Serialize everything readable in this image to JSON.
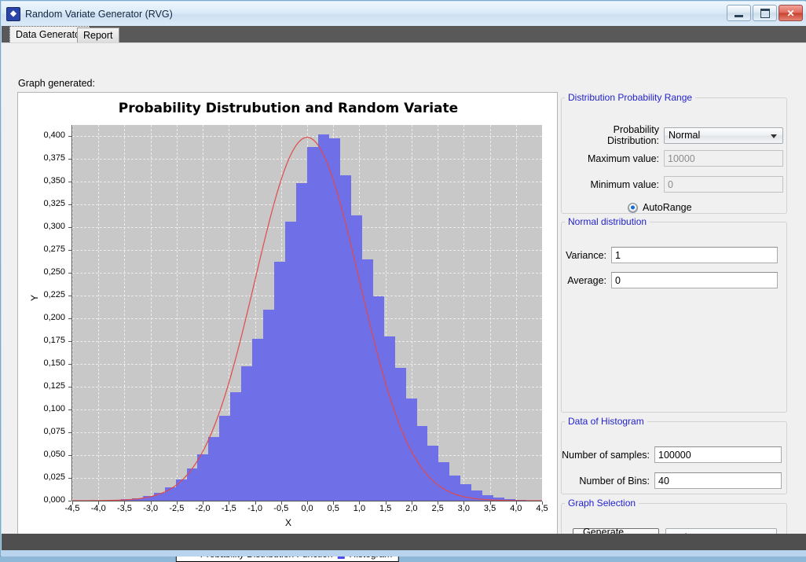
{
  "window": {
    "title": "Random Variate Generator (RVG)",
    "app_icon": "app-logo-icon",
    "minimize_label": "Minimize",
    "maximize_label": "Maximize",
    "close_label": "✕"
  },
  "tabs": [
    {
      "label": "Data Generator",
      "selected": true
    },
    {
      "label": "Report",
      "selected": false
    }
  ],
  "main": {
    "graph_label": "Graph generated:"
  },
  "chart_data": {
    "type": "bar",
    "title": "Probability Distrubution and Random Variate",
    "xlabel": "X",
    "ylabel": "Y",
    "xlim": [
      -4.5,
      4.5
    ],
    "ylim": [
      0.0,
      0.4125
    ],
    "grid": true,
    "legend_position": "bottom",
    "decimal_separator": ",",
    "xticks": [
      "-4,5",
      "-4,0",
      "-3,5",
      "-3,0",
      "-2,5",
      "-2,0",
      "-1,5",
      "-1,0",
      "-0,5",
      "0,0",
      "0,5",
      "1,0",
      "1,5",
      "2,0",
      "2,5",
      "3,0",
      "3,5",
      "4,0",
      "4,5"
    ],
    "xtick_values": [
      -4.5,
      -4.0,
      -3.5,
      -3.0,
      -2.5,
      -2.0,
      -1.5,
      -1.0,
      -0.5,
      0.0,
      0.5,
      1.0,
      1.5,
      2.0,
      2.5,
      3.0,
      3.5,
      4.0,
      4.5
    ],
    "yticks": [
      "0,000",
      "0,025",
      "0,050",
      "0,075",
      "0,100",
      "0,125",
      "0,150",
      "0,175",
      "0,200",
      "0,225",
      "0,250",
      "0,275",
      "0,300",
      "0,325",
      "0,350",
      "0,375",
      "0,400"
    ],
    "ytick_values": [
      0.0,
      0.025,
      0.05,
      0.075,
      0.1,
      0.125,
      0.15,
      0.175,
      0.2,
      0.225,
      0.25,
      0.275,
      0.3,
      0.325,
      0.35,
      0.375,
      0.4
    ],
    "series": [
      {
        "name": "Histogram",
        "type": "bar",
        "color": "#6f6fe8",
        "bin_count": 40,
        "bin_edges": [
          -4.2,
          -3.99,
          -3.78,
          -3.57,
          -3.36,
          -3.15,
          -2.94,
          -2.73,
          -2.52,
          -2.31,
          -2.1,
          -1.89,
          -1.68,
          -1.47,
          -1.26,
          -1.05,
          -0.84,
          -0.63,
          -0.42,
          -0.21,
          0.0,
          0.21,
          0.42,
          0.63,
          0.84,
          1.05,
          1.26,
          1.47,
          1.68,
          1.89,
          2.1,
          2.31,
          2.52,
          2.73,
          2.94,
          3.15,
          3.36,
          3.57,
          3.78,
          3.99,
          4.2
        ],
        "values": [
          0.0002,
          0.0004,
          0.0008,
          0.0016,
          0.003,
          0.0052,
          0.009,
          0.0148,
          0.0232,
          0.035,
          0.0506,
          0.07,
          0.093,
          0.119,
          0.148,
          0.178,
          0.21,
          0.262,
          0.306,
          0.349,
          0.388,
          0.402,
          0.398,
          0.357,
          0.313,
          0.265,
          0.224,
          0.18,
          0.146,
          0.112,
          0.082,
          0.06,
          0.042,
          0.028,
          0.018,
          0.011,
          0.0062,
          0.0034,
          0.0016,
          0.0006
        ]
      },
      {
        "name": "Probability Distribution Function",
        "type": "line",
        "color": "#e04a4a",
        "distribution": "Normal",
        "mean": 0,
        "variance": 1,
        "peak_value": 0.3989
      }
    ],
    "legend": [
      {
        "label": "Probability Distribution Function",
        "marker": "line",
        "color": "#e04a4a"
      },
      {
        "label": "Histogram",
        "marker": "square",
        "color": "#4a4aee"
      }
    ],
    "plot_background": "#c8c8c8",
    "gridline_color": "#ececec"
  },
  "panels": {
    "distribution_range": {
      "legend": "Distribution Probability Range",
      "probability_distribution_label": "Probability Distribution:",
      "probability_distribution_value": "Normal",
      "probability_distribution_options": [
        "Normal"
      ],
      "maximum_label": "Maximum value:",
      "maximum_value": "10000",
      "minimum_label": "Minimum value:",
      "minimum_value": "0",
      "autorange_label": "AutoRange",
      "autorange_checked": true
    },
    "normal_distribution": {
      "legend": "Normal distribution",
      "variance_label": "Variance:",
      "variance_value": "1",
      "average_label": "Average:",
      "average_value": "0"
    },
    "histogram_data": {
      "legend": "Data of Histogram",
      "samples_label": "Number of samples:",
      "samples_value": "100000",
      "bins_label": "Number of Bins:",
      "bins_value": "40"
    },
    "graph_selection": {
      "legend": "Graph Selection",
      "generate_button": "Generate Graph",
      "mode_value": "Both",
      "mode_options": [
        "Both"
      ]
    }
  },
  "colors": {
    "accent": "#2222cc",
    "bar": "#6f6fe8",
    "pdf_line": "#e04a4a",
    "plot_bg": "#c8c8c8"
  }
}
